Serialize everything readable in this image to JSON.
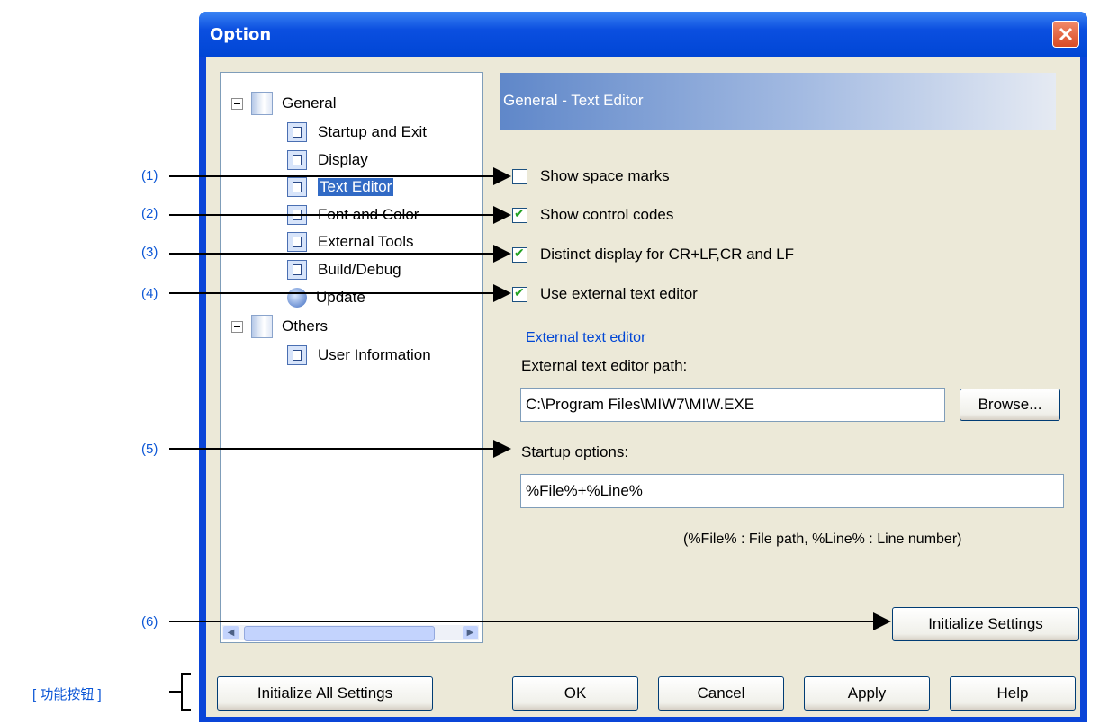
{
  "window": {
    "title": "Option"
  },
  "tree": {
    "items": [
      {
        "label": "General",
        "kind": "folder"
      },
      {
        "label": "Startup and Exit",
        "kind": "page"
      },
      {
        "label": "Display",
        "kind": "page"
      },
      {
        "label": "Text Editor",
        "kind": "page",
        "selected": true
      },
      {
        "label": "Font and Color",
        "kind": "page"
      },
      {
        "label": "External Tools",
        "kind": "page"
      },
      {
        "label": "Build/Debug",
        "kind": "page"
      },
      {
        "label": "Update",
        "kind": "update"
      },
      {
        "label": "Others",
        "kind": "folder"
      },
      {
        "label": "User Information",
        "kind": "page"
      }
    ]
  },
  "panel": {
    "header": "General - Text Editor",
    "options": [
      {
        "label": "Show space marks",
        "checked": false
      },
      {
        "label": "Show control codes",
        "checked": true
      },
      {
        "label": "Distinct display for CR+LF,CR and LF",
        "checked": true
      },
      {
        "label": "Use external text editor",
        "checked": true
      }
    ],
    "group_label": "External text editor",
    "path_label": "External text editor path:",
    "path_value": "C:\\Program Files\\MIW7\\MIW.EXE",
    "browse_label": "Browse...",
    "startup_label": "Startup options:",
    "startup_value": "%File%+%Line%",
    "note": "(%File% : File path, %Line% : Line number)",
    "init_settings_label": "Initialize Settings"
  },
  "footer": {
    "init_all_label": "Initialize All Settings",
    "ok_label": "OK",
    "cancel_label": "Cancel",
    "apply_label": "Apply",
    "help_label": "Help"
  },
  "callouts": {
    "c1": "(1)",
    "c2": "(2)",
    "c3": "(3)",
    "c4": "(4)",
    "c5": "(5)",
    "c6": "(6)",
    "buttons": "[ 功能按钮 ]"
  },
  "colors": {
    "title_bar": "#0a45d8",
    "callout_text": "#0b56d6",
    "dialog_face": "#ece9d8"
  }
}
